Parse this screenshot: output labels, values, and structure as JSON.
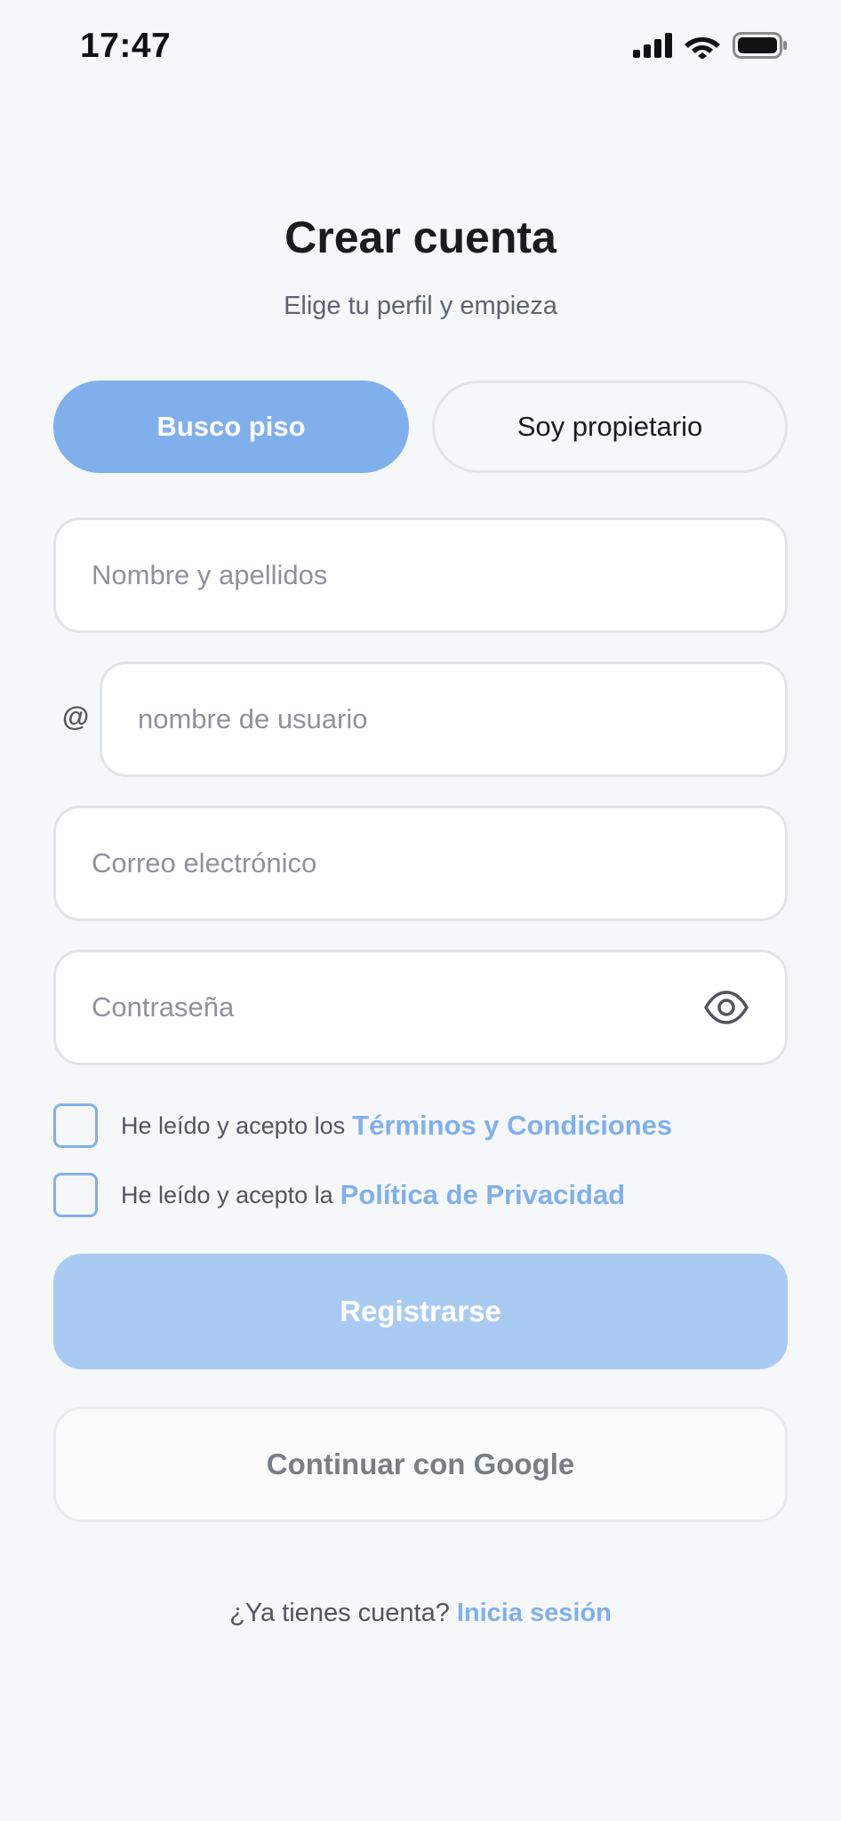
{
  "status_bar": {
    "time": "17:47"
  },
  "header": {
    "title": "Crear cuenta",
    "subtitle": "Elige tu perfil y empieza"
  },
  "role_selector": {
    "options": [
      {
        "label": "Busco piso",
        "selected": true
      },
      {
        "label": "Soy propietario",
        "selected": false
      }
    ]
  },
  "form": {
    "full_name": {
      "placeholder": "Nombre y apellidos",
      "value": ""
    },
    "username": {
      "prefix": "@",
      "placeholder": "nombre de usuario",
      "value": ""
    },
    "email": {
      "placeholder": "Correo electrónico",
      "value": ""
    },
    "password": {
      "placeholder": "Contraseña",
      "value": ""
    }
  },
  "consents": [
    {
      "text": "He leído y acepto los",
      "link": "Términos y Condiciones",
      "checked": false
    },
    {
      "text": "He leído y acepto la",
      "link": "Política de Privacidad",
      "checked": false
    }
  ],
  "actions": {
    "register_label": "Registrarse",
    "google_label": "Continuar con Google"
  },
  "footer": {
    "prompt": "¿Ya tienes cuenta?",
    "link": "Inicia sesión"
  },
  "colors": {
    "accent": "#80b0ec",
    "accent_disabled": "#a9cbf2",
    "background": "#f6f7f9"
  },
  "icons": {
    "signal": "cellular-signal-icon",
    "wifi": "wifi-icon",
    "battery": "battery-icon",
    "password_toggle": "eye-icon"
  }
}
